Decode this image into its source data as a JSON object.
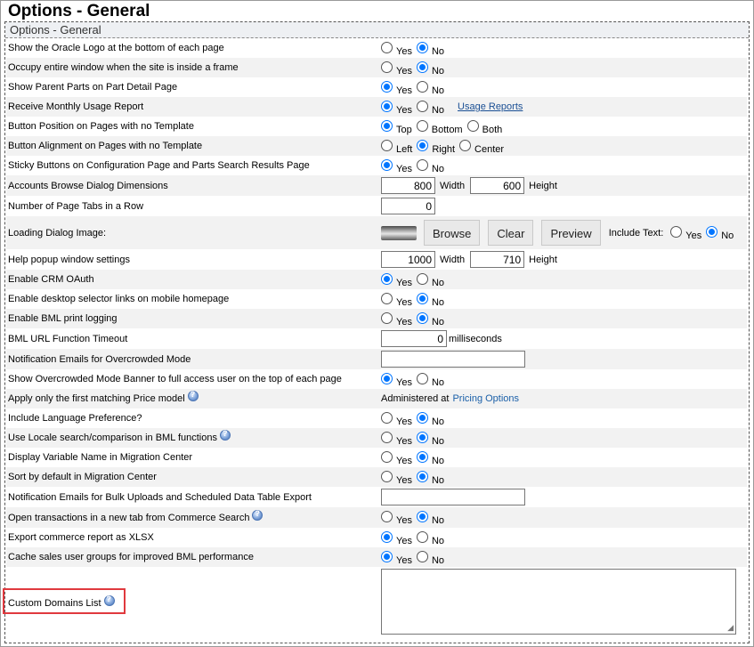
{
  "page_title": "Options - General",
  "panel_header": "Options - General",
  "opt_yes": "Yes",
  "opt_no": "No",
  "rows": {
    "oracle_logo": "Show the Oracle Logo at the bottom of each page",
    "entire_window": "Occupy entire window when the site is inside a frame",
    "parent_parts": "Show Parent Parts on Part Detail Page",
    "usage_report": "Receive Monthly Usage Report",
    "button_position": "Button Position on Pages with no Template",
    "button_alignment": "Button Alignment on Pages with no Template",
    "sticky_buttons": "Sticky Buttons on Configuration Page and Parts Search Results Page",
    "accounts_dims": "Accounts Browse Dialog Dimensions",
    "page_tabs": "Number of Page Tabs in a Row",
    "loading_image": "Loading Dialog Image:",
    "help_popup": "Help popup window settings",
    "crm_oauth": "Enable CRM OAuth",
    "desktop_links": "Enable desktop selector links on mobile homepage",
    "bml_print": "Enable BML print logging",
    "bml_timeout": "BML URL Function Timeout",
    "notif_overcrowded": "Notification Emails for Overcrowded Mode",
    "overcrowded_banner": "Show Overcrowded Mode Banner to full access user on the top of each page",
    "first_price_model": "Apply only the first matching Price model",
    "language_pref": "Include Language Preference?",
    "locale_search": "Use Locale search/comparison in BML functions",
    "variable_name": "Display Variable Name in Migration Center",
    "sort_migration": "Sort by default in Migration Center",
    "notif_bulk": "Notification Emails for Bulk Uploads and Scheduled Data Table Export",
    "open_transactions": "Open transactions in a new tab from Commerce Search",
    "export_xlsx": "Export commerce report as XLSX",
    "cache_groups": "Cache sales user groups for improved BML performance",
    "custom_domains": "Custom Domains List"
  },
  "usage_reports_link": "Usage Reports",
  "pos_top": "Top",
  "pos_bottom": "Bottom",
  "pos_both": "Both",
  "align_left": "Left",
  "align_right": "Right",
  "align_center": "Center",
  "width_label": "Width",
  "height_label": "Height",
  "accounts_width": "800",
  "accounts_height": "600",
  "page_tabs_value": "0",
  "browse_label": "Browse",
  "clear_label": "Clear",
  "preview_label": "Preview",
  "include_text_label": "Include Text:",
  "help_width": "1000",
  "help_height": "710",
  "timeout_value": "0",
  "milliseconds_label": "milliseconds",
  "administered_at": "Administered at",
  "pricing_options_link": "Pricing Options",
  "colors": {
    "accent": "#0075ff",
    "highlight": "#e0393e",
    "link": "#1a5fa8",
    "row_alt": "#f2f2f2"
  }
}
